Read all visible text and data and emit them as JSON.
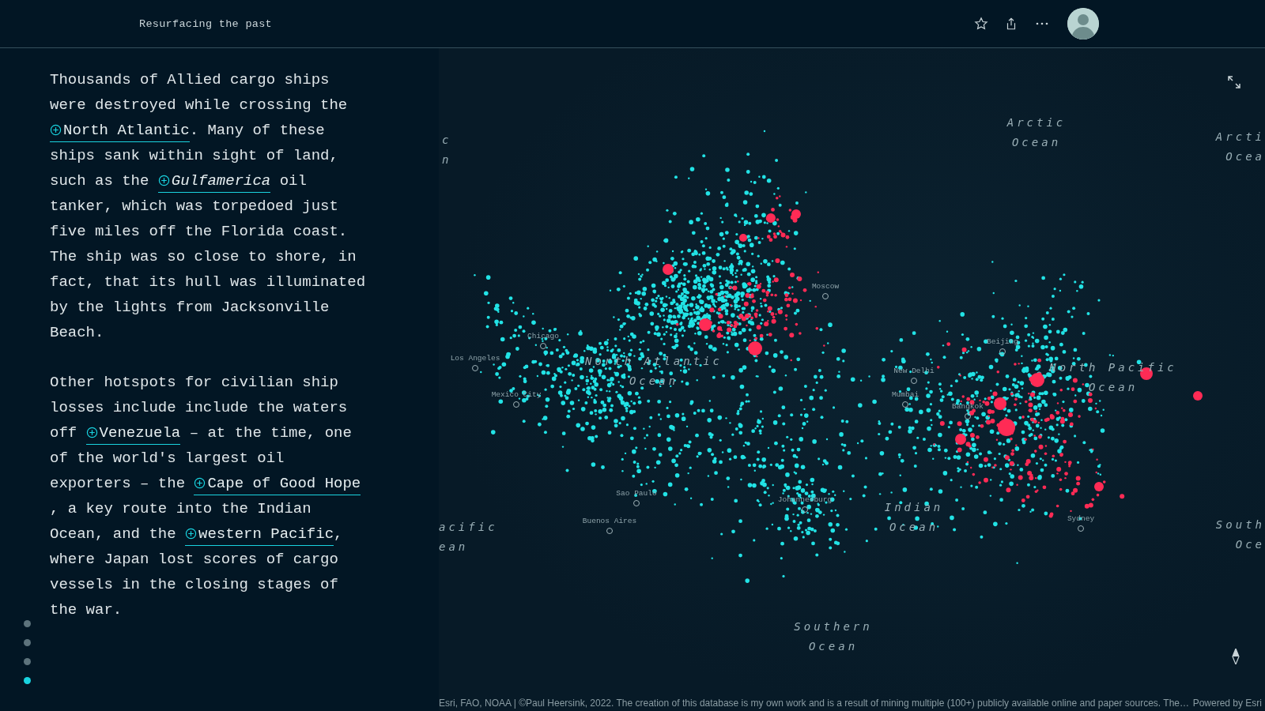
{
  "header": {
    "title": "Resurfacing the past"
  },
  "story": {
    "paragraphs": [
      [
        {
          "kind": "text",
          "text": "Thousands of Allied cargo ships were destroyed while crossing the "
        },
        {
          "kind": "place",
          "text": "North Atlantic"
        },
        {
          "kind": "text",
          "text": ". Many of these ships sank within sight of land, such as the "
        },
        {
          "kind": "place",
          "text": "*Gulfamerica*"
        },
        {
          "kind": "text",
          "text": " oil tanker, which was torpedoed just five miles off the Florida coast. The ship was so close to shore, in fact, that its hull was illuminated by the lights from Jacksonville Beach."
        }
      ],
      [
        {
          "kind": "text",
          "text": "Other hotspots for civilian ship losses include include the waters off "
        },
        {
          "kind": "place",
          "text": "Venezuela"
        },
        {
          "kind": "text",
          "text": " – at the time, one of the world's largest oil exporters – the "
        },
        {
          "kind": "place",
          "text": "Cape of Good Hope"
        },
        {
          "kind": "text",
          "text": " , a key route into the Indian Ocean, and the "
        },
        {
          "kind": "place",
          "text": "western Pacific"
        },
        {
          "kind": "text",
          "text": ", where Japan lost scores of cargo vessels in the closing stages of the war."
        }
      ]
    ]
  },
  "nav_dots": [
    {
      "selected": false
    },
    {
      "selected": false
    },
    {
      "selected": false
    },
    {
      "selected": true
    }
  ],
  "map": {
    "ocean_labels": [
      {
        "lines": [
          "Arctic",
          "Ocean"
        ]
      },
      {
        "lines": [
          "c",
          "n"
        ]
      },
      {
        "lines": [
          "Arcti",
          "Ocea"
        ]
      },
      {
        "lines": [
          "North Atlantic",
          "Ocean"
        ]
      },
      {
        "lines": [
          "North Pacific",
          "Ocean"
        ]
      },
      {
        "lines": [
          "Indian",
          "Ocean"
        ]
      },
      {
        "lines": [
          "acific",
          "ean"
        ]
      },
      {
        "lines": [
          "South",
          "Oce"
        ]
      },
      {
        "lines": [
          "Southern",
          "Ocean"
        ]
      }
    ],
    "cities": [
      "Chicago",
      "Los Angeles",
      "Mexico City",
      "Moscow",
      "New Delhi",
      "Mumbai",
      "Beijing",
      "Bangkok",
      "Sao Paulo",
      "Buenos Aires",
      "Johannesburg",
      "Sydney"
    ],
    "attribution": "Esri, FAO, NOAA | ©Paul Heersink, 2022. The creation of this database is my own work and is a result of mining multiple (100+) publicly available online and paper sources. The…",
    "powered_by": "Powered by Esri"
  }
}
